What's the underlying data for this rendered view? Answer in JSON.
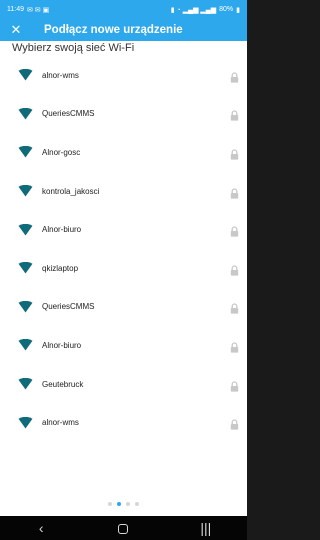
{
  "status_bar": {
    "time": "11:49",
    "battery": "80%"
  },
  "app_bar": {
    "title": "Podłącz nowe urządzenie"
  },
  "heading": "Wybierz swoją sieć Wi-Fi",
  "networks": [
    {
      "name": "alnor-wms",
      "locked": true
    },
    {
      "name": "QueriesCMMS",
      "locked": true
    },
    {
      "name": "Alnor-gosc",
      "locked": true
    },
    {
      "name": "kontrola_jakosci",
      "locked": true
    },
    {
      "name": "Alnor-biuro",
      "locked": true
    },
    {
      "name": "qkizlaptop",
      "locked": true
    },
    {
      "name": "QueriesCMMS",
      "locked": true
    },
    {
      "name": "Alnor-biuro",
      "locked": true
    },
    {
      "name": "Geutebruck",
      "locked": true
    },
    {
      "name": "alnor-wms",
      "locked": true
    }
  ],
  "pager": {
    "total": 4,
    "active": 1
  },
  "colors": {
    "accent": "#2ea8ec",
    "wifi_icon": "#0f6b7a",
    "lock_icon": "#c8c8c8"
  }
}
